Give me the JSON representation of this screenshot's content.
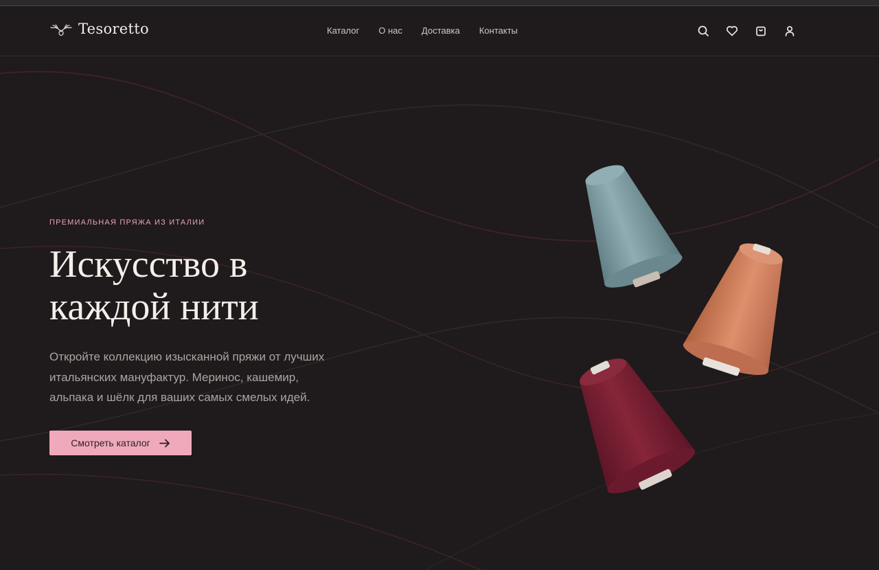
{
  "brand": {
    "name": "Tesoretto"
  },
  "nav": {
    "items": [
      {
        "label": "Каталог"
      },
      {
        "label": "О нас"
      },
      {
        "label": "Доставка"
      },
      {
        "label": "Контакты"
      }
    ]
  },
  "header_icons": [
    "search-icon",
    "heart-icon",
    "bag-icon",
    "user-icon"
  ],
  "hero": {
    "eyebrow": "ПРЕМИАЛЬНАЯ ПРЯЖА ИЗ ИТАЛИИ",
    "title_line1": "Искусство в",
    "title_line2": "каждой нити",
    "description_line1": "Откройте коллекцию изысканной пряжи от лучших",
    "description_line2": "итальянских мануфактур. Меринос, кашемир,",
    "description_line3": "альпака и шёлк для ваших самых смелых идей.",
    "cta_label": "Смотреть каталог",
    "cta_icon": "arrow-right-icon"
  },
  "colors": {
    "background": "#1f1a1b",
    "accent_pink": "#f0a9bb",
    "eyebrow_pink": "#e7a6b5",
    "spool_teal": "#7e9ea5",
    "spool_coral": "#d4825f",
    "spool_burgundy": "#7a1f35"
  }
}
